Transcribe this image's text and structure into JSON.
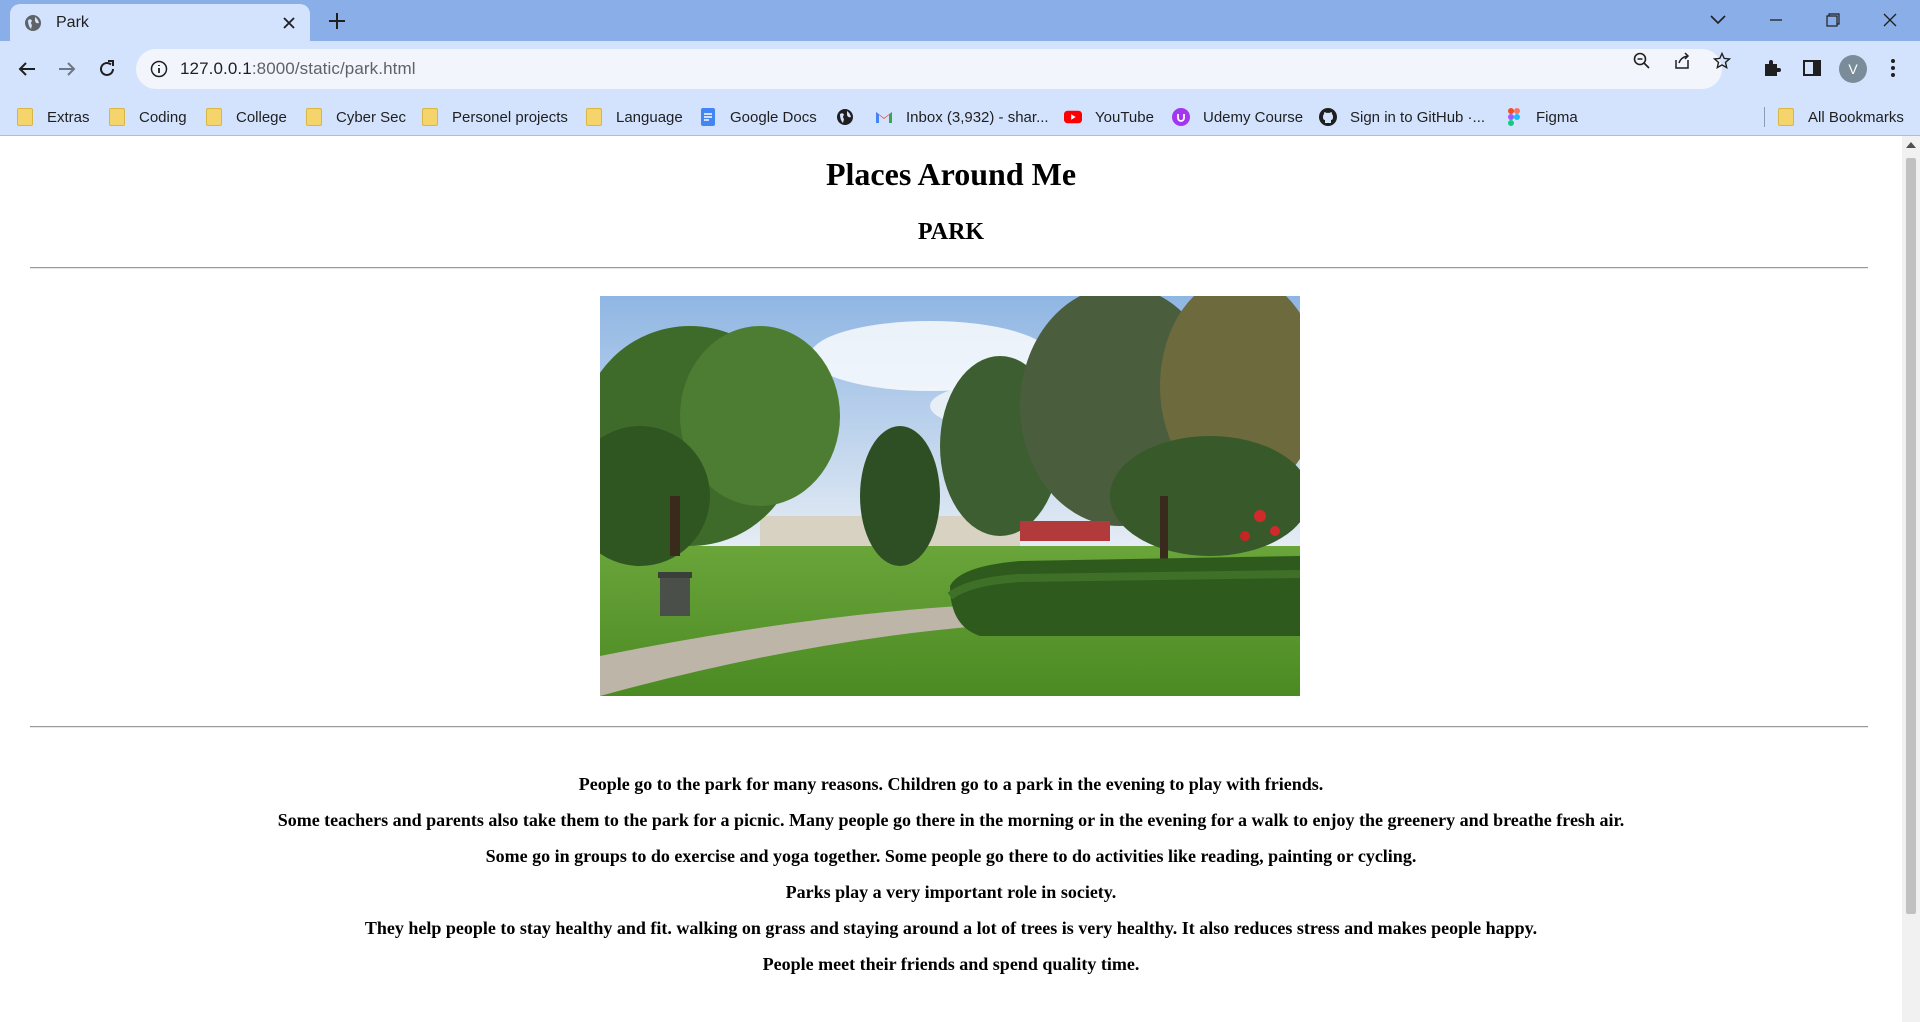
{
  "browser": {
    "tab": {
      "title": "Park",
      "favicon": "globe-icon"
    },
    "url_host": "127.0.0.1",
    "url_rest": ":8000/static/park.html",
    "avatar_letter": "V",
    "accent": "#8aaee8",
    "toolbar_bg": "#d3e3fd"
  },
  "bookmarks": [
    {
      "label": "Extras",
      "icon": "folder-icon"
    },
    {
      "label": "Coding",
      "icon": "folder-icon"
    },
    {
      "label": "College",
      "icon": "folder-icon"
    },
    {
      "label": "Cyber Sec",
      "icon": "folder-icon"
    },
    {
      "label": "Personel projects",
      "icon": "folder-icon"
    },
    {
      "label": "Language",
      "icon": "folder-icon"
    },
    {
      "label": "Google Docs",
      "icon": "google-docs-icon"
    },
    {
      "label": "",
      "icon": "globe-icon"
    },
    {
      "label": "Inbox (3,932) - shar...",
      "icon": "gmail-icon"
    },
    {
      "label": "YouTube",
      "icon": "youtube-icon"
    },
    {
      "label": "Udemy Course",
      "icon": "udemy-icon"
    },
    {
      "label": "Sign in to GitHub ·...",
      "icon": "github-icon"
    },
    {
      "label": "Figma",
      "icon": "figma-icon"
    }
  ],
  "all_bookmarks": "All Bookmarks",
  "page": {
    "title": "Places Around Me",
    "subtitle": "PARK",
    "paragraphs": [
      "People go to the park for many reasons. Children go to a park in the evening to play with friends.",
      "Some teachers and parents also take them to the park for a picnic. Many people go there in the morning or in the evening for a walk to enjoy the greenery and breathe fresh air.",
      "Some go in groups to do exercise and yoga together. Some people go there to do activities like reading, painting or cycling.",
      "Parks play a very important role in society.",
      "They help people to stay healthy and fit. walking on grass and staying around a lot of trees is very healthy. It also reduces stress and makes people happy.",
      "People meet their friends and spend quality time."
    ]
  }
}
